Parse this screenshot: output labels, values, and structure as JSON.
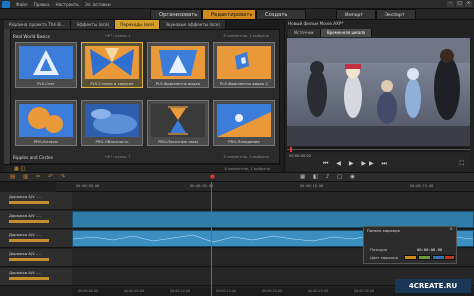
{
  "menubar": {
    "items": [
      "Файл",
      "Правка",
      "Настроить",
      "Эл. вставки"
    ]
  },
  "modes": [
    {
      "label": "Организовать",
      "active": false
    },
    {
      "label": "Редактировать",
      "active": true
    },
    {
      "label": "Создать DVD",
      "active": false
    }
  ],
  "top_right": {
    "import": "Импорт",
    "export": "Экспорт"
  },
  "library": {
    "tabs": [
      {
        "label": "Корзина проекта  Thé Bi...",
        "active": false
      },
      {
        "label": "Эффекты (все)",
        "active": false
      },
      {
        "label": "Переходы (все)",
        "active": true
      },
      {
        "label": "Звуковые эффекты (все)",
        "active": false
      }
    ],
    "groups": [
      {
        "title": "Real World Basics",
        "sub": "НЕТ группы 1",
        "count": "8 элементов, 1 выбрано"
      },
      {
        "title": "Ripples and Circles",
        "sub": "НЕТ группы 7",
        "count": "8 элементов, 0 выбрано"
      }
    ],
    "thumbnails": [
      {
        "caption": "PLS-Снег",
        "selected": false
      },
      {
        "caption": "PLS-Стекло в хаоукие",
        "selected": true
      },
      {
        "caption": "PLS-Фрагменты видео",
        "selected": false
      },
      {
        "caption": "PLS-Фрагменты видео 2",
        "selected": false
      },
      {
        "caption": "PRG-Кляксы",
        "selected": false
      },
      {
        "caption": "PRG-Облачность",
        "selected": false
      },
      {
        "caption": "PRG-Песочные часы",
        "selected": false
      },
      {
        "caption": "PRG-Попадание",
        "selected": false
      }
    ],
    "footer": "8 элементов, 1 выбрано"
  },
  "preview": {
    "title": "Новый фильм Movie.AXP*",
    "tabs": [
      {
        "label": "Источник",
        "active": false
      },
      {
        "label": "Временная шкала",
        "active": true
      }
    ],
    "timecode": "00:00:00.00"
  },
  "timeline": {
    "ruler": [
      "00:00:00.00",
      "00:00:05.00",
      "00:00:10.00",
      "00:00:15.00"
    ],
    "tracks": [
      {
        "name": "Дорожка A/V ...."
      },
      {
        "name": "Дорожка A/V ...."
      },
      {
        "name": "Дорожка A/V ...."
      },
      {
        "name": "Дорожка A/V ...."
      },
      {
        "name": "Дорожка A/V ...."
      }
    ],
    "bottom_ruler": [
      "00:00:00.00",
      "00:00:05.00",
      "00:00:10.00",
      "00:00:15.00",
      "00:00:20.00",
      "00:00:25.00",
      "00:00:30.00",
      "00:00:35.00",
      "00:00:40.00"
    ]
  },
  "marker_panel": {
    "title": "Панель маркера",
    "position_label": "Позиция",
    "color_label": "Цвет маркера",
    "position_value": "00:00:00.00",
    "colors": [
      "#d28a1c",
      "#6a9a3a",
      "#3a6fb0",
      "#c0392b"
    ]
  },
  "watermark": "4CREATE.RU"
}
